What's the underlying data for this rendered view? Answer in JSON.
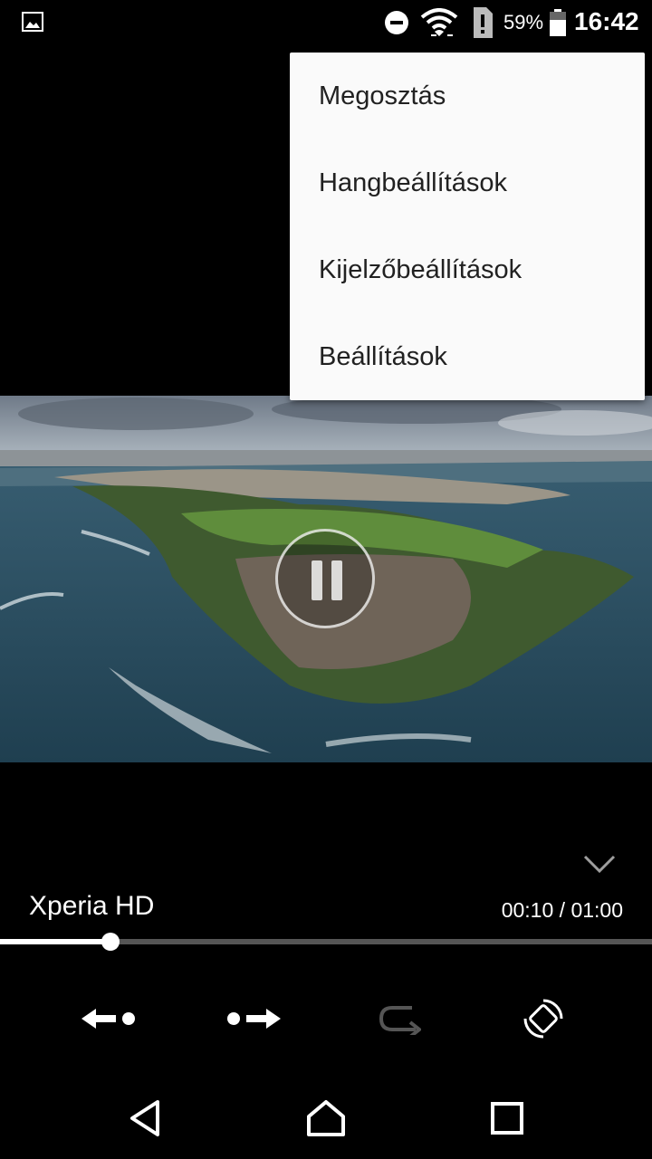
{
  "status_bar": {
    "battery_percent": "59%",
    "time": "16:42",
    "icons": [
      "gallery-icon",
      "do-not-disturb-icon",
      "wifi-icon",
      "sim-alert-icon",
      "battery-icon"
    ]
  },
  "menu": {
    "items": [
      {
        "label": "Megosztás"
      },
      {
        "label": "Hangbeállítások"
      },
      {
        "label": "Kijelzőbeállítások"
      },
      {
        "label": "Beállítások"
      }
    ]
  },
  "player": {
    "title": "Xperia HD",
    "current_time": "00:10",
    "separator": " / ",
    "duration": "01:00",
    "progress": 0.17,
    "state": "playing",
    "controls": [
      "rewind-icon",
      "forward-icon",
      "repeat-icon",
      "rotate-icon"
    ]
  },
  "nav_bar": {
    "icons": [
      "back-icon",
      "home-icon",
      "recents-icon"
    ]
  }
}
